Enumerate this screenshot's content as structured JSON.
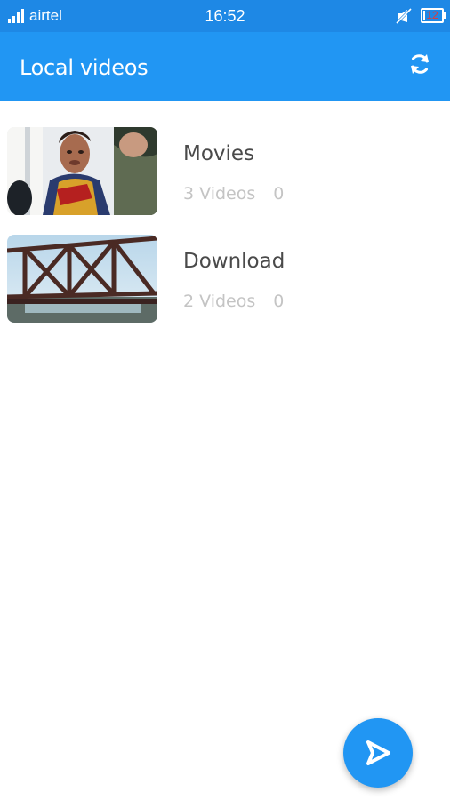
{
  "status_bar": {
    "carrier": "airtel",
    "time": "16:52",
    "battery_level": "12",
    "battery_fraction": 0.12
  },
  "app_bar": {
    "title": "Local videos",
    "refresh_icon": "refresh-icon"
  },
  "folders": [
    {
      "name": "Movies",
      "count_label": "3 Videos",
      "size_label": "0",
      "thumbnail": "thumbnail-person-icon"
    },
    {
      "name": "Download",
      "count_label": "2 Videos",
      "size_label": "0",
      "thumbnail": "thumbnail-bridge-icon"
    }
  ],
  "fab": {
    "icon": "play-icon"
  },
  "colors": {
    "status_bar": "#1e88e5",
    "app_bar": "#2196f3",
    "accent": "#2196f3",
    "primary_text": "#4a4a4a",
    "secondary_text": "#c4c4c4"
  }
}
